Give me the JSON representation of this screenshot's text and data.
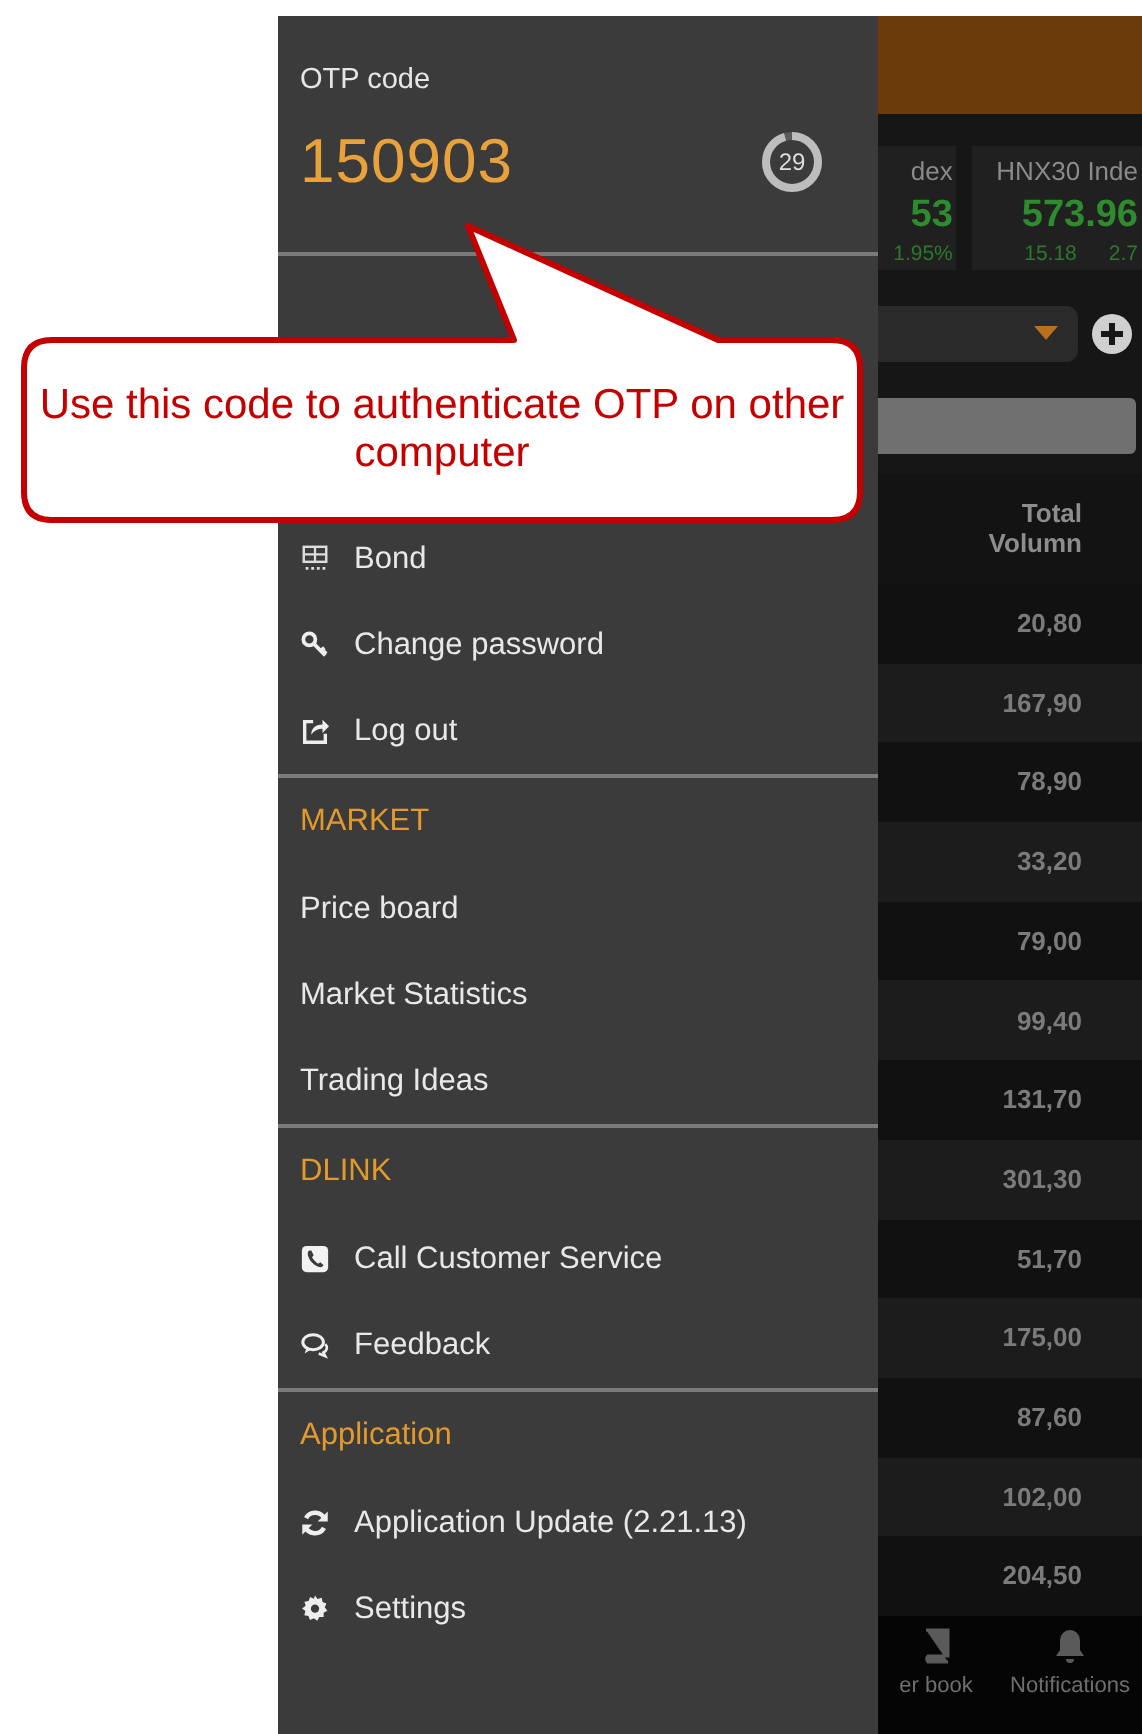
{
  "drawer": {
    "otp": {
      "label": "OTP code",
      "code": "150903",
      "countdown": "29",
      "level": 0.95
    },
    "items": [
      {
        "label": "Bond"
      },
      {
        "label": "Change password"
      },
      {
        "label": "Log out"
      }
    ],
    "sections": [
      {
        "title": "MARKET",
        "items": [
          {
            "label": "Price board"
          },
          {
            "label": "Market Statistics"
          },
          {
            "label": "Trading Ideas"
          }
        ]
      },
      {
        "title": "DLINK",
        "items": [
          {
            "label": "Call Customer Service"
          },
          {
            "label": "Feedback"
          }
        ]
      },
      {
        "title": "Application",
        "items": [
          {
            "label": "Application Update (2.21.13)"
          },
          {
            "label": "Settings"
          }
        ]
      }
    ]
  },
  "callout": {
    "text": "Use this code to authenticate OTP on other computer"
  },
  "background_app": {
    "index_cards": [
      {
        "name": "dex",
        "value": "53",
        "change": "1.95%"
      },
      {
        "name": "HNX30 Inde",
        "value": "573.96",
        "change": "15.18",
        "percent": "2.7"
      }
    ],
    "table": {
      "column": "Total Volumn",
      "rows": [
        "20,80",
        "167,90",
        "78,90",
        "33,20",
        "79,00",
        "99,40",
        "131,70",
        "301,30",
        "51,70",
        "175,00",
        "87,60",
        "102,00",
        "204,50"
      ]
    },
    "nav": [
      {
        "label": "er book"
      },
      {
        "label": "Notifications"
      }
    ]
  }
}
